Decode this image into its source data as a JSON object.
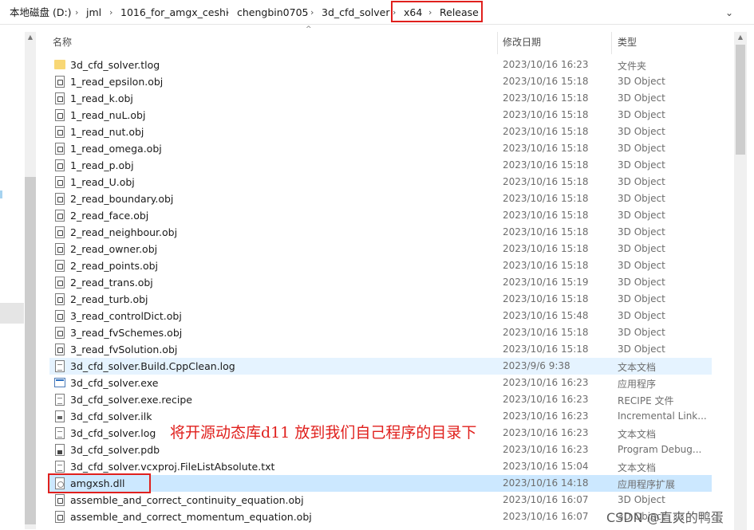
{
  "breadcrumb": [
    "本地磁盘 (D:)",
    "jml",
    "1016_for_amgx_ceshi",
    "chengbin0705",
    "3d_cfd_solver",
    "x64",
    "Release"
  ],
  "columns": {
    "name": "名称",
    "date": "修改日期",
    "type": "类型"
  },
  "files": [
    {
      "name": "3d_cfd_solver.tlog",
      "date": "2023/10/16 16:23",
      "type": "文件夹",
      "icon": "folder"
    },
    {
      "name": "1_read_epsilon.obj",
      "date": "2023/10/16 15:18",
      "type": "3D Object",
      "icon": "obj"
    },
    {
      "name": "1_read_k.obj",
      "date": "2023/10/16 15:18",
      "type": "3D Object",
      "icon": "obj"
    },
    {
      "name": "1_read_nuL.obj",
      "date": "2023/10/16 15:18",
      "type": "3D Object",
      "icon": "obj"
    },
    {
      "name": "1_read_nut.obj",
      "date": "2023/10/16 15:18",
      "type": "3D Object",
      "icon": "obj"
    },
    {
      "name": "1_read_omega.obj",
      "date": "2023/10/16 15:18",
      "type": "3D Object",
      "icon": "obj"
    },
    {
      "name": "1_read_p.obj",
      "date": "2023/10/16 15:18",
      "type": "3D Object",
      "icon": "obj"
    },
    {
      "name": "1_read_U.obj",
      "date": "2023/10/16 15:18",
      "type": "3D Object",
      "icon": "obj"
    },
    {
      "name": "2_read_boundary.obj",
      "date": "2023/10/16 15:18",
      "type": "3D Object",
      "icon": "obj"
    },
    {
      "name": "2_read_face.obj",
      "date": "2023/10/16 15:18",
      "type": "3D Object",
      "icon": "obj"
    },
    {
      "name": "2_read_neighbour.obj",
      "date": "2023/10/16 15:18",
      "type": "3D Object",
      "icon": "obj"
    },
    {
      "name": "2_read_owner.obj",
      "date": "2023/10/16 15:18",
      "type": "3D Object",
      "icon": "obj"
    },
    {
      "name": "2_read_points.obj",
      "date": "2023/10/16 15:18",
      "type": "3D Object",
      "icon": "obj"
    },
    {
      "name": "2_read_trans.obj",
      "date": "2023/10/16 15:19",
      "type": "3D Object",
      "icon": "obj"
    },
    {
      "name": "2_read_turb.obj",
      "date": "2023/10/16 15:18",
      "type": "3D Object",
      "icon": "obj"
    },
    {
      "name": "3_read_controlDict.obj",
      "date": "2023/10/16 15:48",
      "type": "3D Object",
      "icon": "obj"
    },
    {
      "name": "3_read_fvSchemes.obj",
      "date": "2023/10/16 15:18",
      "type": "3D Object",
      "icon": "obj"
    },
    {
      "name": "3_read_fvSolution.obj",
      "date": "2023/10/16 15:18",
      "type": "3D Object",
      "icon": "obj"
    },
    {
      "name": "3d_cfd_solver.Build.CppClean.log",
      "date": "2023/9/6 9:38",
      "type": "文本文档",
      "icon": "txt",
      "state": "hover"
    },
    {
      "name": "3d_cfd_solver.exe",
      "date": "2023/10/16 16:23",
      "type": "应用程序",
      "icon": "exe"
    },
    {
      "name": "3d_cfd_solver.exe.recipe",
      "date": "2023/10/16 16:23",
      "type": "RECIPE 文件",
      "icon": "txt"
    },
    {
      "name": "3d_cfd_solver.ilk",
      "date": "2023/10/16 16:23",
      "type": "Incremental Link...",
      "icon": "ilk"
    },
    {
      "name": "3d_cfd_solver.log",
      "date": "2023/10/16 16:23",
      "type": "文本文档",
      "icon": "txt"
    },
    {
      "name": "3d_cfd_solver.pdb",
      "date": "2023/10/16 16:23",
      "type": "Program Debug...",
      "icon": "pdb"
    },
    {
      "name": "3d_cfd_solver.vcxproj.FileListAbsolute.txt",
      "date": "2023/10/16 15:04",
      "type": "文本文档",
      "icon": "txt"
    },
    {
      "name": "amgxsh.dll",
      "date": "2023/10/16 14:18",
      "type": "应用程序扩展",
      "icon": "dll",
      "state": "selected"
    },
    {
      "name": "assemble_and_correct_continuity_equation.obj",
      "date": "2023/10/16 16:07",
      "type": "3D Object",
      "icon": "obj"
    },
    {
      "name": "assemble_and_correct_momentum_equation.obj",
      "date": "2023/10/16 16:07",
      "type": "3D Object",
      "icon": "obj"
    }
  ],
  "annotation": "将开源动态库d11 放到我们自己程序的目录下",
  "watermark": "CSDN @直爽的鸭蛋",
  "colors": {
    "highlight": "#e0201d",
    "selected": "#cce8ff",
    "hover": "#e5f3ff"
  }
}
